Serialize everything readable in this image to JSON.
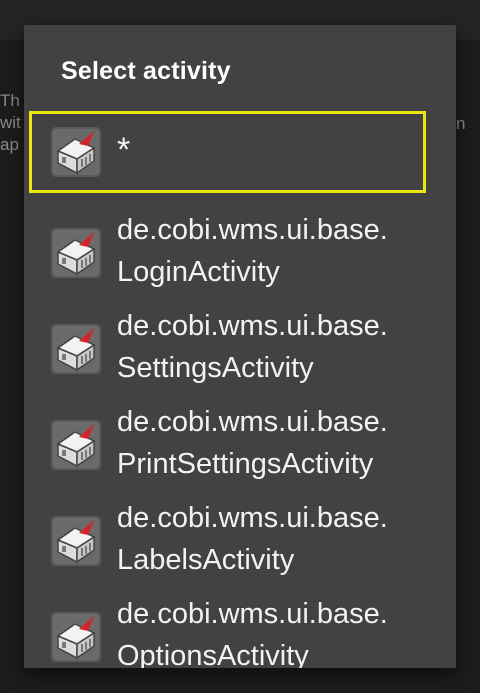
{
  "background": {
    "partial_text_left": "Th\nwit\nap",
    "partial_text_right": "n"
  },
  "dialog": {
    "title": "Select activity",
    "items": [
      {
        "line1": "*",
        "line2": "",
        "icon": "app-icon",
        "selected": true
      },
      {
        "line1": "de.cobi.wms.ui.base.",
        "line2": "LoginActivity",
        "icon": "app-icon"
      },
      {
        "line1": "de.cobi.wms.ui.base.",
        "line2": "SettingsActivity",
        "icon": "app-icon"
      },
      {
        "line1": "de.cobi.wms.ui.base.",
        "line2": "PrintSettingsActivity",
        "icon": "app-icon"
      },
      {
        "line1": "de.cobi.wms.ui.base.",
        "line2": "LabelsActivity",
        "icon": "app-icon"
      },
      {
        "line1": "de.cobi.wms.ui.base.",
        "line2": "OptionsActivity",
        "icon": "app-icon"
      }
    ],
    "colors": {
      "highlight": "#f0e611",
      "dialog_bg": "#424242",
      "icon_accent": "#d3242a"
    }
  }
}
